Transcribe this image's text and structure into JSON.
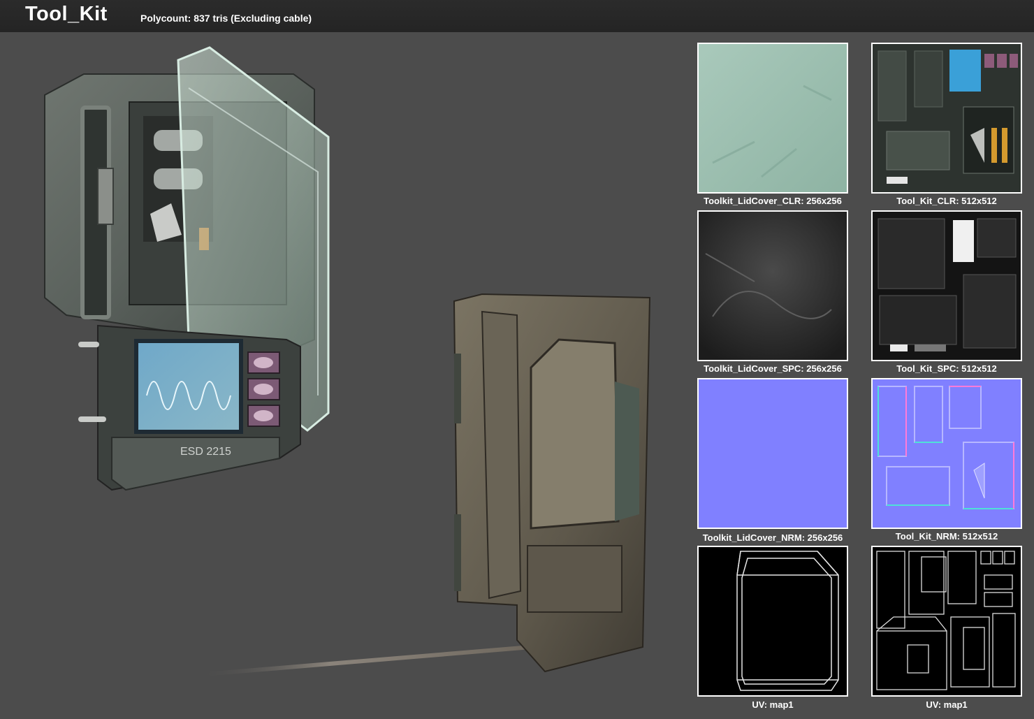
{
  "header": {
    "title": "Tool_Kit",
    "polycount": "Polycount: 837 tris (Excluding cable)"
  },
  "model": {
    "device_label": "ESD 2215"
  },
  "textures": [
    {
      "label": "Toolkit_LidCover_CLR: 256x256",
      "kind": "lid-color"
    },
    {
      "label": "Tool_Kit_CLR: 512x512",
      "kind": "kit-color"
    },
    {
      "label": "Toolkit_LidCover_SPC: 256x256",
      "kind": "lid-spec"
    },
    {
      "label": "Tool_Kit_SPC: 512x512",
      "kind": "kit-spec"
    },
    {
      "label": "Toolkit_LidCover_NRM: 256x256",
      "kind": "lid-normal"
    },
    {
      "label": "Tool_Kit_NRM: 512x512",
      "kind": "kit-normal"
    },
    {
      "label": "UV: map1",
      "kind": "lid-uv"
    },
    {
      "label": "UV: map1",
      "kind": "kit-uv"
    }
  ],
  "colors": {
    "background": "#4c4c4c",
    "header": "#262626",
    "normal_map": "#8080ff",
    "lid_color": "#9cbfb0"
  }
}
